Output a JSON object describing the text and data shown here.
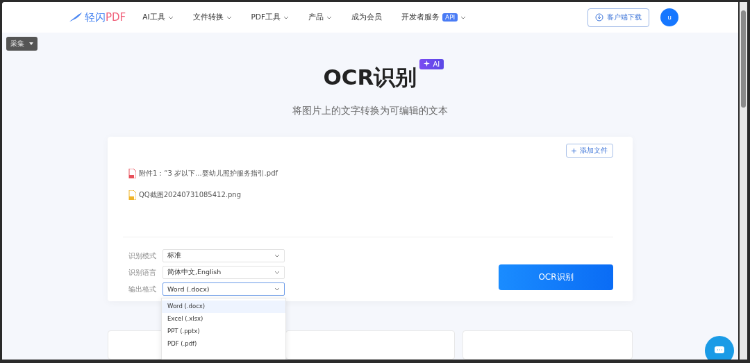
{
  "window_tag": {
    "label": "采集"
  },
  "header": {
    "logo": {
      "name": "轻闪",
      "suffix": "PDF"
    },
    "nav": [
      {
        "label": "AI工具",
        "dropdown": true
      },
      {
        "label": "文件转换",
        "dropdown": true
      },
      {
        "label": "PDF工具",
        "dropdown": true
      },
      {
        "label": "产品",
        "dropdown": true
      },
      {
        "label": "成为会员",
        "dropdown": false
      },
      {
        "label": "开发者服务",
        "badge": "API",
        "dropdown": true
      }
    ],
    "download_button": "客户端下载",
    "avatar": "u"
  },
  "hero": {
    "title": "OCR识别",
    "badge": "AI",
    "subtitle": "将图片上的文字转换为可编辑的文本"
  },
  "upload": {
    "add_button": "添加文件",
    "files": [
      {
        "name": "附件1：“3 岁以下...婴幼儿照护服务指引.pdf",
        "kind": "pdf"
      },
      {
        "name": "QQ截图20240731085412.png",
        "kind": "image"
      }
    ]
  },
  "settings": [
    {
      "label": "识别模式",
      "value": "标准",
      "open": false
    },
    {
      "label": "识别语言",
      "value": "简体中文,English",
      "open": false
    },
    {
      "label": "输出格式",
      "value": "Word (.docx)",
      "open": true,
      "options": [
        {
          "label": "Word (.docx)",
          "selected": true
        },
        {
          "label": "Excel (.xlsx)",
          "selected": false
        },
        {
          "label": "PPT (.pptx)",
          "selected": false
        },
        {
          "label": "PDF (.pdf)",
          "selected": false
        }
      ]
    }
  ],
  "submit_button": "OCR识别"
}
